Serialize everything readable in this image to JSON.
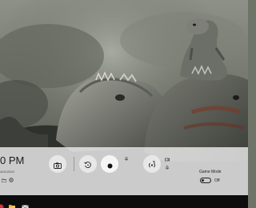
{
  "game_bar": {
    "clock": {
      "time": "0 PM",
      "date": "4/01/2020"
    },
    "toggle_state": "Off",
    "game_mode_label": "Game Mode"
  },
  "icons": {
    "screenshot": "camera-icon",
    "record_last": "replay-icon",
    "record": "record-dot-icon",
    "broadcast": "broadcast-icon",
    "settings": "gear-icon",
    "xbox": "xbox-icon"
  },
  "taskbar": {
    "items": [
      "start-icon",
      "file-explorer-icon",
      "mail-icon"
    ]
  },
  "colors": {
    "panel": "#e8e8e8",
    "taskbar": "#0d0d0d",
    "accent_red": "#d13438"
  }
}
